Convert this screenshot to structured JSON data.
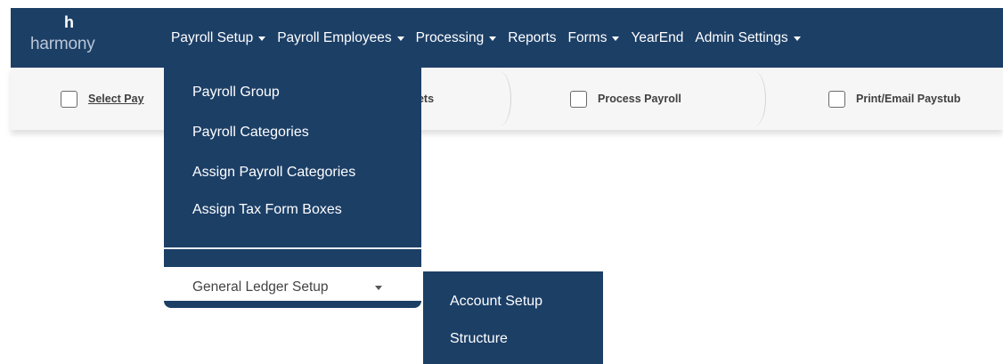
{
  "brand": {
    "mark": "h",
    "name": "harmony"
  },
  "nav": [
    {
      "label": "Payroll Setup",
      "has_caret": true
    },
    {
      "label": "Payroll Employees",
      "has_caret": true
    },
    {
      "label": "Processing",
      "has_caret": true
    },
    {
      "label": "Reports",
      "has_caret": false
    },
    {
      "label": "Forms",
      "has_caret": true
    },
    {
      "label": "YearEnd",
      "has_caret": false
    },
    {
      "label": "Admin Settings",
      "has_caret": true
    }
  ],
  "steps": [
    {
      "label": "Select Pay",
      "checked": false
    },
    {
      "label": "eets",
      "checked": false
    },
    {
      "label": "Process Payroll",
      "checked": false
    },
    {
      "label": "Print/Email Paystub",
      "checked": false
    }
  ],
  "payroll_setup_menu": {
    "items": [
      "Payroll Group",
      "Payroll Categories",
      "Assign Payroll Categories",
      "Assign Tax Form Boxes"
    ],
    "general_ledger": {
      "label": "General Ledger Setup",
      "subitems": [
        "Account Setup",
        "Structure"
      ]
    }
  },
  "colors": {
    "nav_bg": "#1c3f66",
    "menu_bg": "#1c3f66",
    "nav_text": "#ffffff",
    "step_bar_bg": "#f6f6f6",
    "logo_text": "#b9c6d6"
  }
}
